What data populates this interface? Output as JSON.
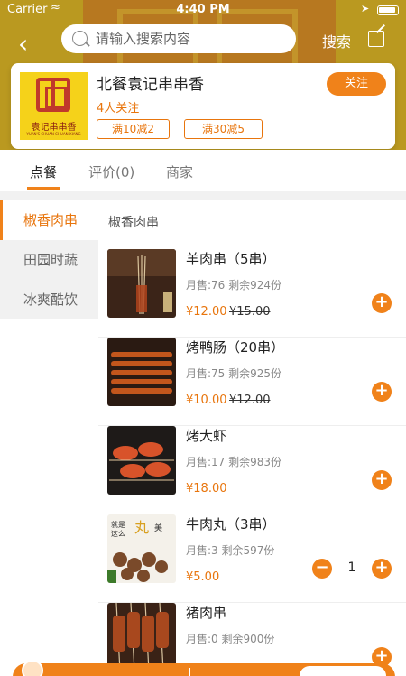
{
  "status_bar": {
    "carrier": "Carrier",
    "time": "4:40 PM"
  },
  "header": {
    "search_placeholder": "请输入搜索内容",
    "search_label": "搜索"
  },
  "store": {
    "name": "北餐袁记串串香",
    "follow_count": "4人关注",
    "follow_label": "关注",
    "logo_text": "袁记串串香",
    "logo_sub": "YUAN'S CHUAN CHUAN XIANG",
    "coupons": [
      "满10减2",
      "满30减5"
    ]
  },
  "tabs": [
    {
      "label": "点餐",
      "active": true
    },
    {
      "label": "评价(0)",
      "active": false
    },
    {
      "label": "商家",
      "active": false
    }
  ],
  "categories": [
    {
      "label": "椒香肉串",
      "active": true
    },
    {
      "label": "田园时蔬",
      "active": false
    },
    {
      "label": "冰爽酷饮",
      "active": false
    }
  ],
  "section_title": "椒香肉串",
  "items": [
    {
      "name": "羊肉串（5串）",
      "stats": "月售:76  剩余924份",
      "price": "¥12.00",
      "old_price": "¥15.00",
      "qty": null
    },
    {
      "name": "烤鸭肠（20串）",
      "stats": "月售:75  剩余925份",
      "price": "¥10.00",
      "old_price": "¥12.00",
      "qty": null
    },
    {
      "name": "烤大虾",
      "stats": "月售:17  剩余983份",
      "price": "¥18.00",
      "old_price": "",
      "qty": null
    },
    {
      "name": "牛肉丸（3串）",
      "stats": "月售:3  剩余597份",
      "price": "¥5.00",
      "old_price": "",
      "qty": "1"
    },
    {
      "name": "猪肉串",
      "stats": "月售:0  剩余900份",
      "price": "",
      "old_price": "",
      "qty": null
    }
  ],
  "colors": {
    "accent": "#f0821a",
    "header_bg": "#c6a42a"
  }
}
